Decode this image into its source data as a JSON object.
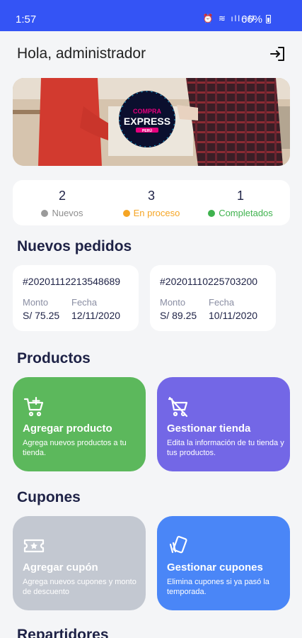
{
  "status_bar": {
    "time": "1:57",
    "icons": "⏰ ≋ ıll ıll",
    "battery": "66%"
  },
  "header": {
    "greeting": "Hola, administrador"
  },
  "banner": {
    "logo_line1": "COMPRA",
    "logo_line2": "EXPRESS",
    "logo_line3": "PERÚ"
  },
  "stats": [
    {
      "count": "2",
      "label": "Nuevos",
      "color": "#9a9a9a"
    },
    {
      "count": "3",
      "label": "En proceso",
      "color": "#f5a524"
    },
    {
      "count": "1",
      "label": "Completados",
      "color": "#3fb24e"
    }
  ],
  "orders_section": {
    "title": "Nuevos pedidos"
  },
  "orders": [
    {
      "code": "#20201112213548689",
      "amount_label": "Monto",
      "amount": "S/ 75.25",
      "date_label": "Fecha",
      "date": "12/11/2020"
    },
    {
      "code": "#20201110225703200",
      "amount_label": "Monto",
      "amount": "S/ 89.25",
      "date_label": "Fecha",
      "date": "10/11/2020"
    }
  ],
  "products_section": {
    "title": "Productos",
    "cards": [
      {
        "title": "Agregar producto",
        "desc": "Agrega nuevos productos a tu tienda.",
        "color": "#5cb85c",
        "icon": "cart-plus-icon"
      },
      {
        "title": "Gestionar tienda",
        "desc": "Edita la información de tu tienda y tus productos.",
        "color": "#7367e6",
        "icon": "cart-off-icon"
      }
    ]
  },
  "coupons_section": {
    "title": "Cupones",
    "cards": [
      {
        "title": "Agregar cupón",
        "desc": "Agrega nuevos cupones y monto de descuento",
        "color": "#c3c8d1",
        "icon": "ticket-star-icon"
      },
      {
        "title": "Gestionar cupones",
        "desc": "Elimina cupones si ya pasó la temporada.",
        "color": "#4a86f7",
        "icon": "coupon-cards-icon"
      }
    ]
  },
  "delivery_section": {
    "title": "Repartidores"
  }
}
